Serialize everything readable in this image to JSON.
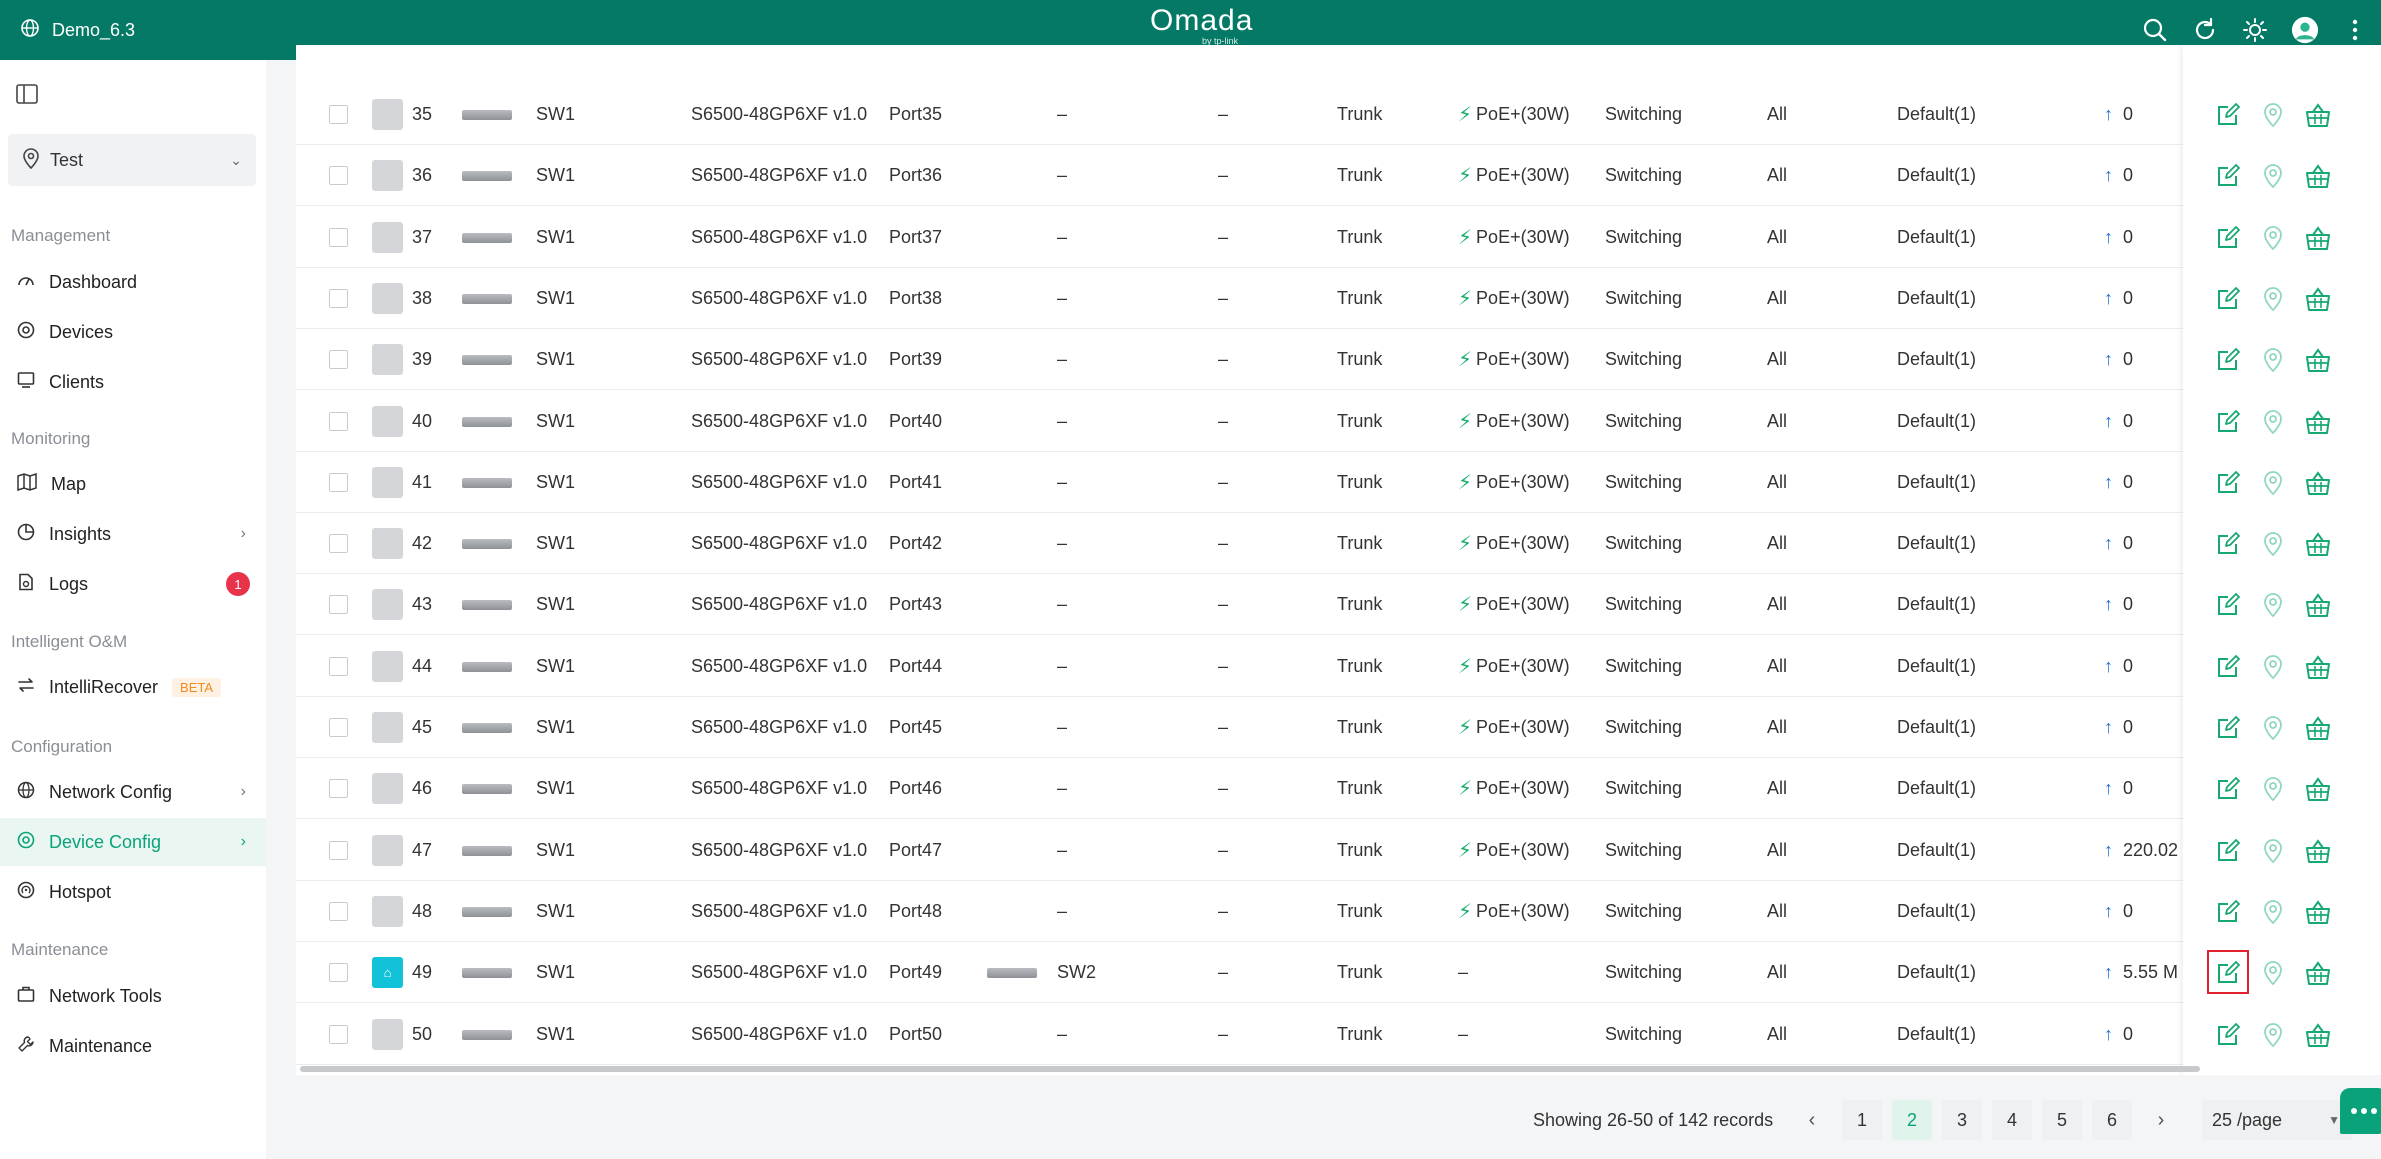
{
  "topbar": {
    "site_name": "Demo_6.3",
    "logo_text": "Omada",
    "logo_sub": "by tp-link",
    "icons": [
      "search-icon",
      "refresh-icon",
      "theme-icon",
      "avatar",
      "more-icon"
    ]
  },
  "sidebar": {
    "site_select": "Test",
    "groups": {
      "management": "Management",
      "monitoring": "Monitoring",
      "intelligent": "Intelligent O&M",
      "configuration": "Configuration",
      "maintenance": "Maintenance"
    },
    "items": {
      "dashboard": "Dashboard",
      "devices": "Devices",
      "clients": "Clients",
      "map": "Map",
      "insights": "Insights",
      "logs": "Logs",
      "logs_badge": "1",
      "intellirecover": "IntelliRecover",
      "beta": "BETA",
      "network_config": "Network Config",
      "device_config": "Device Config",
      "hotspot": "Hotspot",
      "network_tools": "Network Tools",
      "maintenance": "Maintenance"
    }
  },
  "table": {
    "rows": [
      {
        "num": "35",
        "device": "SW1",
        "model": "S6500-48GP6XF v1.0",
        "port": "Port35",
        "neighbor": "–",
        "col7": "–",
        "mode": "Trunk",
        "poe": "PoE+(30W)",
        "status": "Switching",
        "vlan": "All",
        "profile": "Default(1)",
        "rate": "0",
        "online": false,
        "neighbor_dev": false
      },
      {
        "num": "36",
        "device": "SW1",
        "model": "S6500-48GP6XF v1.0",
        "port": "Port36",
        "neighbor": "–",
        "col7": "–",
        "mode": "Trunk",
        "poe": "PoE+(30W)",
        "status": "Switching",
        "vlan": "All",
        "profile": "Default(1)",
        "rate": "0",
        "online": false,
        "neighbor_dev": false
      },
      {
        "num": "37",
        "device": "SW1",
        "model": "S6500-48GP6XF v1.0",
        "port": "Port37",
        "neighbor": "–",
        "col7": "–",
        "mode": "Trunk",
        "poe": "PoE+(30W)",
        "status": "Switching",
        "vlan": "All",
        "profile": "Default(1)",
        "rate": "0",
        "online": false,
        "neighbor_dev": false
      },
      {
        "num": "38",
        "device": "SW1",
        "model": "S6500-48GP6XF v1.0",
        "port": "Port38",
        "neighbor": "–",
        "col7": "–",
        "mode": "Trunk",
        "poe": "PoE+(30W)",
        "status": "Switching",
        "vlan": "All",
        "profile": "Default(1)",
        "rate": "0",
        "online": false,
        "neighbor_dev": false
      },
      {
        "num": "39",
        "device": "SW1",
        "model": "S6500-48GP6XF v1.0",
        "port": "Port39",
        "neighbor": "–",
        "col7": "–",
        "mode": "Trunk",
        "poe": "PoE+(30W)",
        "status": "Switching",
        "vlan": "All",
        "profile": "Default(1)",
        "rate": "0",
        "online": false,
        "neighbor_dev": false
      },
      {
        "num": "40",
        "device": "SW1",
        "model": "S6500-48GP6XF v1.0",
        "port": "Port40",
        "neighbor": "–",
        "col7": "–",
        "mode": "Trunk",
        "poe": "PoE+(30W)",
        "status": "Switching",
        "vlan": "All",
        "profile": "Default(1)",
        "rate": "0",
        "online": false,
        "neighbor_dev": false
      },
      {
        "num": "41",
        "device": "SW1",
        "model": "S6500-48GP6XF v1.0",
        "port": "Port41",
        "neighbor": "–",
        "col7": "–",
        "mode": "Trunk",
        "poe": "PoE+(30W)",
        "status": "Switching",
        "vlan": "All",
        "profile": "Default(1)",
        "rate": "0",
        "online": false,
        "neighbor_dev": false
      },
      {
        "num": "42",
        "device": "SW1",
        "model": "S6500-48GP6XF v1.0",
        "port": "Port42",
        "neighbor": "–",
        "col7": "–",
        "mode": "Trunk",
        "poe": "PoE+(30W)",
        "status": "Switching",
        "vlan": "All",
        "profile": "Default(1)",
        "rate": "0",
        "online": false,
        "neighbor_dev": false
      },
      {
        "num": "43",
        "device": "SW1",
        "model": "S6500-48GP6XF v1.0",
        "port": "Port43",
        "neighbor": "–",
        "col7": "–",
        "mode": "Trunk",
        "poe": "PoE+(30W)",
        "status": "Switching",
        "vlan": "All",
        "profile": "Default(1)",
        "rate": "0",
        "online": false,
        "neighbor_dev": false
      },
      {
        "num": "44",
        "device": "SW1",
        "model": "S6500-48GP6XF v1.0",
        "port": "Port44",
        "neighbor": "–",
        "col7": "–",
        "mode": "Trunk",
        "poe": "PoE+(30W)",
        "status": "Switching",
        "vlan": "All",
        "profile": "Default(1)",
        "rate": "0",
        "online": false,
        "neighbor_dev": false
      },
      {
        "num": "45",
        "device": "SW1",
        "model": "S6500-48GP6XF v1.0",
        "port": "Port45",
        "neighbor": "–",
        "col7": "–",
        "mode": "Trunk",
        "poe": "PoE+(30W)",
        "status": "Switching",
        "vlan": "All",
        "profile": "Default(1)",
        "rate": "0",
        "online": false,
        "neighbor_dev": false
      },
      {
        "num": "46",
        "device": "SW1",
        "model": "S6500-48GP6XF v1.0",
        "port": "Port46",
        "neighbor": "–",
        "col7": "–",
        "mode": "Trunk",
        "poe": "PoE+(30W)",
        "status": "Switching",
        "vlan": "All",
        "profile": "Default(1)",
        "rate": "0",
        "online": false,
        "neighbor_dev": false
      },
      {
        "num": "47",
        "device": "SW1",
        "model": "S6500-48GP6XF v1.0",
        "port": "Port47",
        "neighbor": "–",
        "col7": "–",
        "mode": "Trunk",
        "poe": "PoE+(30W)",
        "status": "Switching",
        "vlan": "All",
        "profile": "Default(1)",
        "rate": "220.02",
        "online": false,
        "neighbor_dev": false
      },
      {
        "num": "48",
        "device": "SW1",
        "model": "S6500-48GP6XF v1.0",
        "port": "Port48",
        "neighbor": "–",
        "col7": "–",
        "mode": "Trunk",
        "poe": "PoE+(30W)",
        "status": "Switching",
        "vlan": "All",
        "profile": "Default(1)",
        "rate": "0",
        "online": false,
        "neighbor_dev": false
      },
      {
        "num": "49",
        "device": "SW1",
        "model": "S6500-48GP6XF v1.0",
        "port": "Port49",
        "neighbor": "SW2",
        "col7": "–",
        "mode": "Trunk",
        "poe": "–",
        "status": "Switching",
        "vlan": "All",
        "profile": "Default(1)",
        "rate": "5.55 M",
        "online": true,
        "neighbor_dev": true
      },
      {
        "num": "50",
        "device": "SW1",
        "model": "S6500-48GP6XF v1.0",
        "port": "Port50",
        "neighbor": "–",
        "col7": "–",
        "mode": "Trunk",
        "poe": "–",
        "status": "Switching",
        "vlan": "All",
        "profile": "Default(1)",
        "rate": "0",
        "online": false,
        "neighbor_dev": false
      }
    ],
    "highlighted_row": 14
  },
  "pagination": {
    "records": "Showing 26-50 of 142 records",
    "pages": [
      "1",
      "2",
      "3",
      "4",
      "5",
      "6"
    ],
    "current_page": "2",
    "prev": "‹",
    "next": "›",
    "per_page": "25 /page"
  },
  "colors": {
    "brand": "#047a66",
    "accent": "#0aa27a",
    "badge": "#e8334a",
    "highlight": "#e0212f"
  }
}
